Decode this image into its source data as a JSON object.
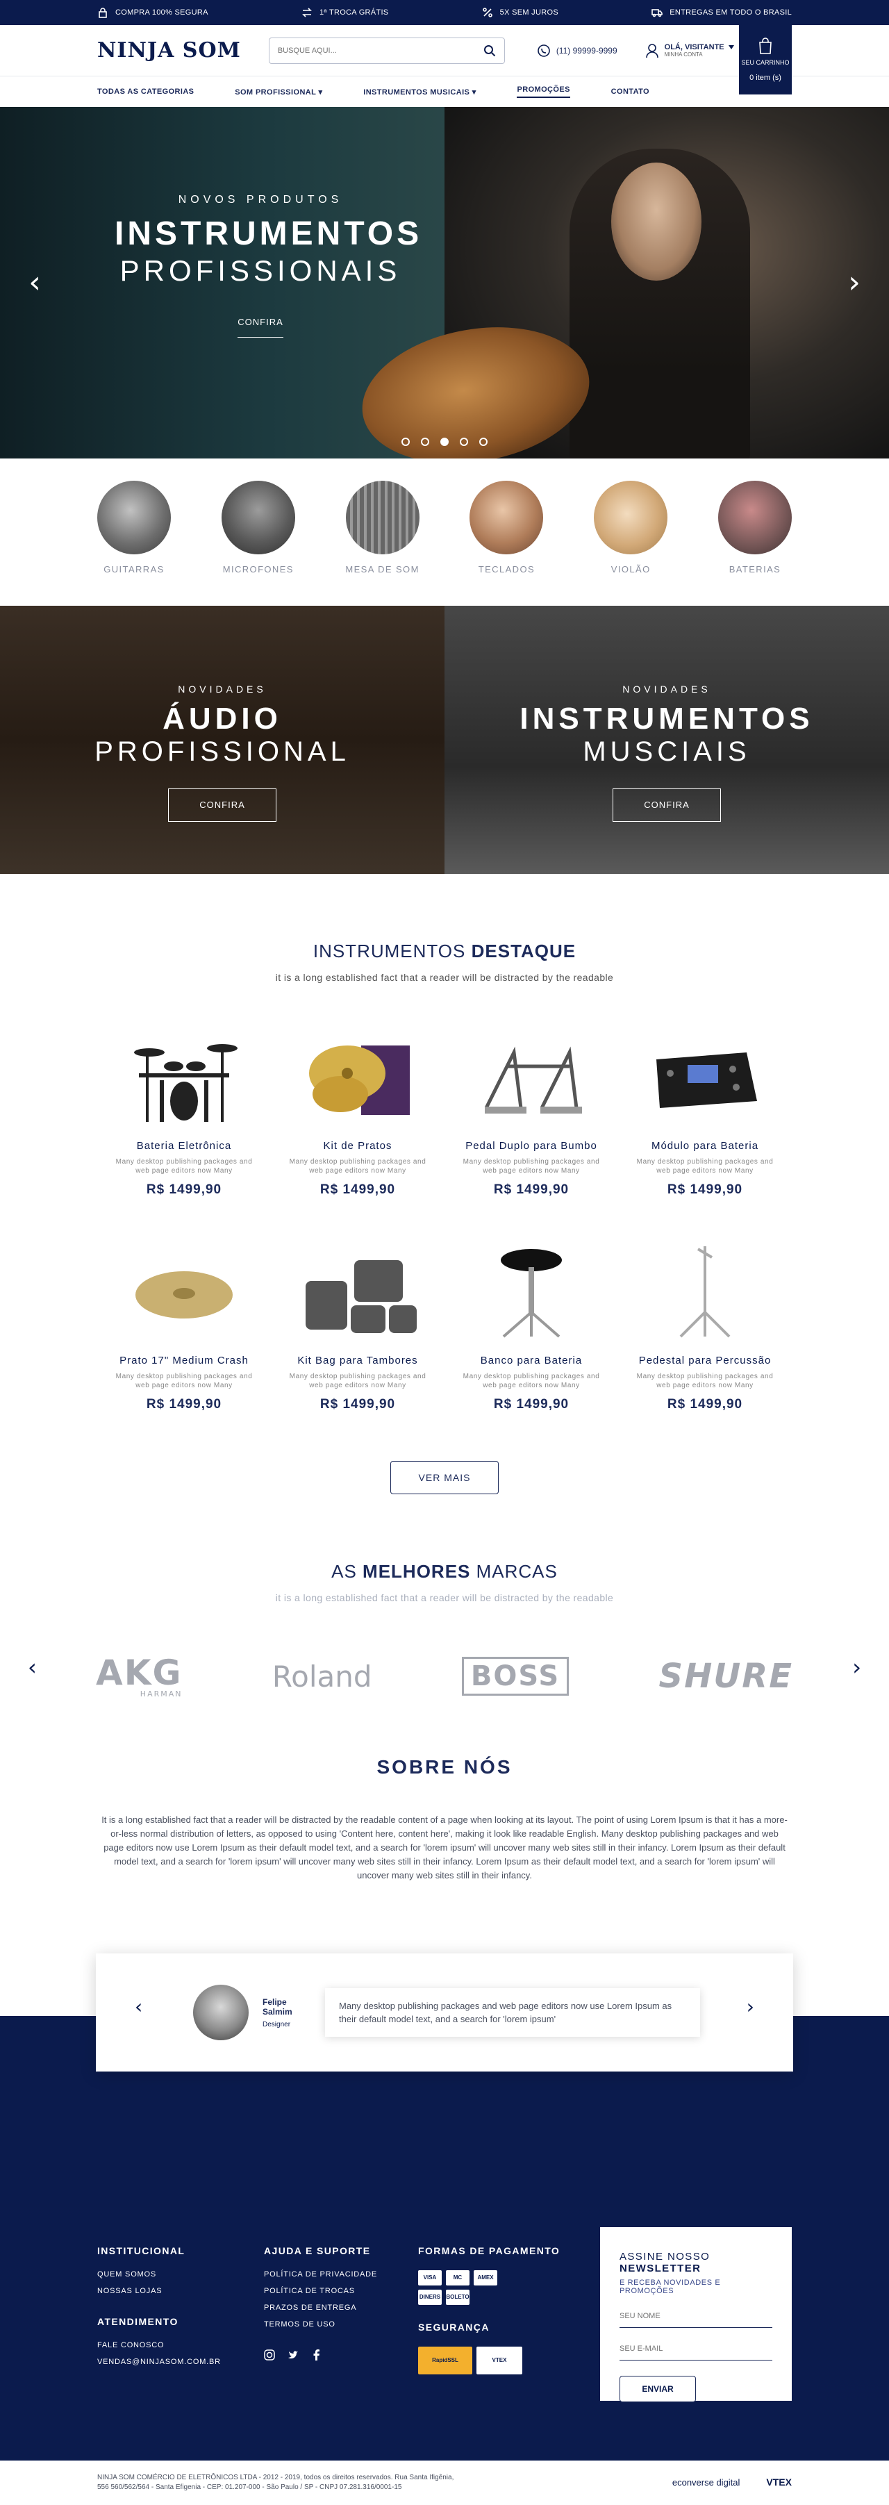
{
  "topbar": {
    "items": [
      {
        "icon": "lock-icon",
        "text": "COMPRA 100% SEGURA"
      },
      {
        "icon": "exchange-icon",
        "text": "1ª TROCA GRÁTIS"
      },
      {
        "icon": "percent-icon",
        "text": "5X SEM JUROS"
      },
      {
        "icon": "truck-icon",
        "text": "ENTREGAS EM TODO O BRASIL"
      }
    ]
  },
  "header": {
    "logo": "NINJA SOM",
    "search_placeholder": "BUSQUE AQUI...",
    "phone": "(11) 99999-9999",
    "user_greeting": "OLÁ, VISITANTE",
    "user_sub": "MINHA CONTA",
    "cart_label": "SEU CARRINHO",
    "cart_count": "0 item (s)"
  },
  "nav": [
    "TODAS AS CATEGORIAS",
    "SOM PROFISSIONAL ▾",
    "INSTRUMENTOS MUSICAIS ▾",
    "PROMOÇÕES",
    "CONTATO"
  ],
  "hero": {
    "kicker": "NOVOS PRODUTOS",
    "title": "INSTRUMENTOS",
    "subtitle": "PROFISSIONAIS",
    "cta": "CONFIRA",
    "slides": 5,
    "active_slide": 3
  },
  "categories": [
    "GUITARRAS",
    "MICROFONES",
    "MESA DE SOM",
    "TECLADOS",
    "VIOLÃO",
    "BATERIAS"
  ],
  "banners": [
    {
      "kicker": "NOVIDADES",
      "title": "ÁUDIO",
      "subtitle": "PROFISSIONAL",
      "cta": "CONFIRA"
    },
    {
      "kicker": "NOVIDADES",
      "title": "INSTRUMENTOS",
      "subtitle": "MUSCIAIS",
      "cta": "CONFIRA"
    }
  ],
  "featured": {
    "title_light": "INSTRUMENTOS",
    "title_bold": "DESTAQUE",
    "subtitle": "it is a long established fact that a reader will be distracted by the readable",
    "products": [
      {
        "name": "Bateria Eletrônica",
        "desc": "Many desktop publishing packages and web page editors now Many",
        "price": "R$ 1499,90"
      },
      {
        "name": "Kit de Pratos",
        "desc": "Many desktop publishing packages and web page editors now Many",
        "price": "R$ 1499,90"
      },
      {
        "name": "Pedal Duplo para Bumbo",
        "desc": "Many desktop publishing packages and web page editors now Many",
        "price": "R$ 1499,90"
      },
      {
        "name": "Módulo para Bateria",
        "desc": "Many desktop publishing packages and web page editors now Many",
        "price": "R$ 1499,90"
      },
      {
        "name": "Prato 17\" Medium Crash",
        "desc": "Many desktop publishing packages and web page editors now Many",
        "price": "R$ 1499,90"
      },
      {
        "name": "Kit Bag para Tambores",
        "desc": "Many desktop publishing packages and web page editors now Many",
        "price": "R$ 1499,90"
      },
      {
        "name": "Banco para Bateria",
        "desc": "Many desktop publishing packages and web page editors now Many",
        "price": "R$ 1499,90"
      },
      {
        "name": "Pedestal para Percussão",
        "desc": "Many desktop publishing packages and web page editors now Many",
        "price": "R$ 1499,90"
      }
    ],
    "more": "VER MAIS"
  },
  "brands": {
    "title_light": "AS",
    "title_bold": "MELHORES",
    "title_end": "MARCAS",
    "subtitle": "it is a long established fact that a reader will be distracted by the readable",
    "items": [
      "AKG",
      "Roland",
      "BOSS",
      "SHURE"
    ],
    "akg_sub": "HARMAN"
  },
  "about": {
    "title": "SOBRE NÓS",
    "text": "It is a long established fact that a reader will be distracted by the readable content of a page when looking at its layout. The point of using Lorem Ipsum is that it has a more-or-less normal distribution of letters, as opposed to using 'Content here, content here', making it look like readable English. Many desktop publishing packages and web page editors now use Lorem Ipsum as their default model text, and a search for 'lorem ipsum' will uncover many web sites still in their infancy. Lorem Ipsum as their default model text, and a search for 'lorem ipsum' will uncover many web sites still in their infancy. Lorem Ipsum as their default model text, and a search for 'lorem ipsum' will uncover many web sites still in their infancy."
  },
  "testimonial": {
    "name": "Felipe Salmim",
    "role": "Designer",
    "quote": "Many desktop publishing packages and web page editors now use Lorem Ipsum as their default model text, and a search for 'lorem ipsum'"
  },
  "footer": {
    "institucional_title": "INSTITUCIONAL",
    "institucional": [
      "QUEM SOMOS",
      "NOSSAS LOJAS"
    ],
    "atendimento_title": "ATENDIMENTO",
    "atendimento": [
      "FALE CONOSCO",
      "VENDAS@NINJASOM.COM.BR"
    ],
    "ajuda_title": "AJUDA E SUPORTE",
    "ajuda": [
      "POLÍTICA DE PRIVACIDADE",
      "POLÍTICA DE TROCAS",
      "PRAZOS DE ENTREGA",
      "TERMOS DE USO"
    ],
    "pagamento_title": "FORMAS DE PAGAMENTO",
    "pagamento": [
      "VISA",
      "MC",
      "AMEX",
      "DINERS",
      "BOLETO"
    ],
    "seguranca_title": "SEGURANÇA",
    "seguranca": [
      "RapidSSL",
      "VTEX"
    ],
    "social": [
      "instagram-icon",
      "twitter-icon",
      "facebook-icon"
    ]
  },
  "newsletter": {
    "title_light": "ASSINE NOSSO",
    "title_bold": "NEWSLETTER",
    "subtitle": "E RECEBA NOVIDADES E PROMOÇÕES",
    "name_placeholder": "SEU NOME",
    "email_placeholder": "SEU E-MAIL",
    "button": "ENVIAR"
  },
  "legal": {
    "line1": "NINJA SOM COMÉRCIO DE ELETRÔNICOS LTDA - 2012 - 2019, todos os direitos reservados. Rua Santa Ifigênia,",
    "line2": "556 560/562/564 - Santa Efigenia - CEP: 01.207-000 - São Paulo / SP - CNPJ 07.281.316/0001-15",
    "dev": "econverse digital",
    "platform": "VTEX"
  }
}
